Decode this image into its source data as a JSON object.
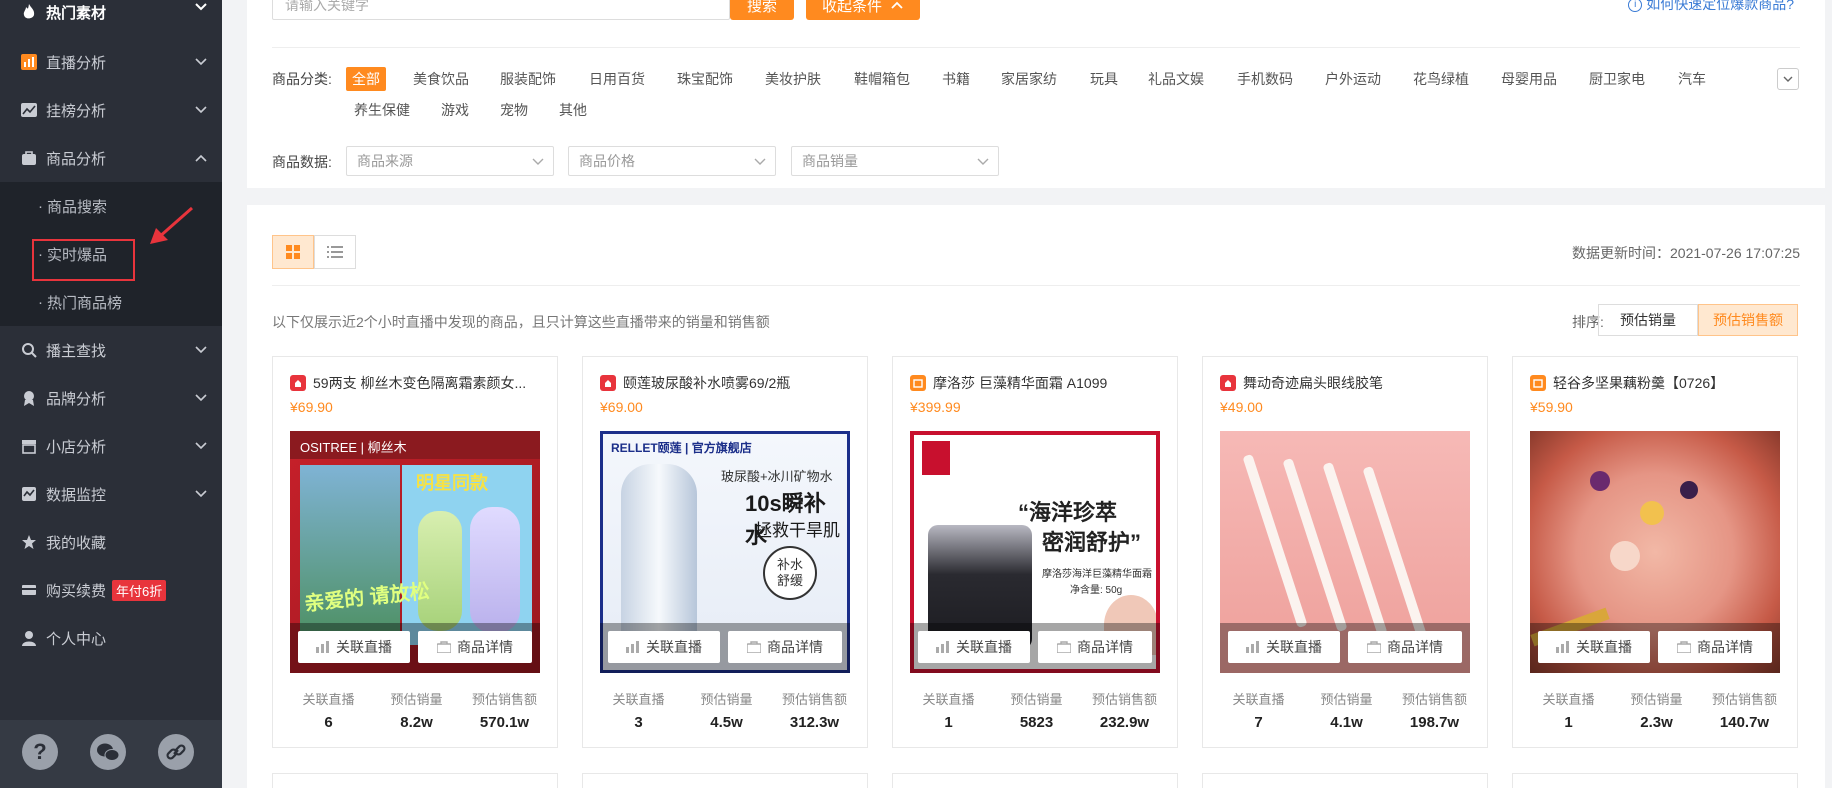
{
  "sidebar": {
    "top_item": "热门素材",
    "items": [
      {
        "label": "直播分析",
        "icon": "bar-chart-icon"
      },
      {
        "label": "挂榜分析",
        "icon": "line-chart-icon"
      },
      {
        "label": "商品分析",
        "icon": "bag-icon"
      },
      {
        "label": "播主查找",
        "icon": "search-icon"
      },
      {
        "label": "品牌分析",
        "icon": "badge-icon"
      },
      {
        "label": "小店分析",
        "icon": "shop-icon"
      },
      {
        "label": "数据监控",
        "icon": "monitor-icon"
      },
      {
        "label": "我的收藏",
        "icon": "star-icon"
      },
      {
        "label": "购买续费",
        "icon": "card-icon",
        "badge": "年付6折"
      },
      {
        "label": "个人中心",
        "icon": "user-icon"
      }
    ],
    "sub_items": [
      "商品搜索",
      "实时爆品",
      "热门商品榜"
    ],
    "footer_icons": [
      "help-icon",
      "wechat-icon",
      "link-icon"
    ]
  },
  "search": {
    "placeholder": "请输入关键字",
    "search_button": "搜索",
    "collapse_button": "收起条件",
    "help_link": "如何快速定位爆款商品?"
  },
  "filters": {
    "category_label": "商品分类:",
    "categories": [
      "全部",
      "美食饮品",
      "服装配饰",
      "日用百货",
      "珠宝配饰",
      "美妆护肤",
      "鞋帽箱包",
      "书籍",
      "家居家纺",
      "玩具",
      "礼品文娱",
      "手机数码",
      "户外运动",
      "花鸟绿植",
      "母婴用品",
      "厨卫家电",
      "汽车",
      "养生保健",
      "游戏",
      "宠物",
      "其他"
    ],
    "data_label": "商品数据:",
    "selects": [
      "商品来源",
      "商品价格",
      "商品销量"
    ]
  },
  "toolbar": {
    "update_time": "数据更新时间：2021-07-26 17:07:25",
    "note": "以下仅展示近2个小时直播中发现的商品，且只计算这些直播带来的销量和销售额",
    "sort_label": "排序:",
    "sort_options": [
      "预估销量",
      "预估销售额"
    ]
  },
  "card_labels": {
    "related_live": "关联直播",
    "product_detail": "商品详情",
    "stat_related": "关联直播",
    "stat_sales": "预估销量",
    "stat_revenue": "预估销售额"
  },
  "products": [
    {
      "title": "59两支 柳丝木变色隔离霜素颜女...",
      "price": "¥69.90",
      "shop_color": "#e8343c",
      "related": "6",
      "sales": "8.2w",
      "revenue": "570.1w",
      "img_text1": "OSITREE | 柳丝木",
      "img_text2": "明星同款",
      "img_text3": "亲爱的 请放松"
    },
    {
      "title": "颐莲玻尿酸补水喷雾69/2瓶",
      "price": "¥69.00",
      "shop_color": "#e8343c",
      "related": "3",
      "sales": "4.5w",
      "revenue": "312.3w",
      "img_text1": "RELLET颐莲 | 官方旗舰店",
      "img_text2": "玻尿酸+冰川矿物水",
      "img_text3": "10s瞬补水",
      "img_text4": "拯救干旱肌",
      "img_text5": "补水舒缓"
    },
    {
      "title": "摩洛莎 巨藻精华面霜 A1099",
      "price": "¥399.99",
      "shop_color": "#ff8a1f",
      "related": "1",
      "sales": "5823",
      "revenue": "232.9w",
      "img_text1": "“海洋珍萃",
      "img_text2": "密润舒护”",
      "img_text3": "摩洛莎海洋巨藻精华面霜",
      "img_text4": "净含量: 50g"
    },
    {
      "title": "舞动奇迹扁头眼线胶笔",
      "price": "¥49.00",
      "shop_color": "#e8343c",
      "related": "7",
      "sales": "4.1w",
      "revenue": "198.7w"
    },
    {
      "title": "轻谷多坚果藕粉羹【0726】",
      "price": "¥59.90",
      "shop_color": "#ff8a1f",
      "related": "1",
      "sales": "2.3w",
      "revenue": "140.7w"
    }
  ]
}
